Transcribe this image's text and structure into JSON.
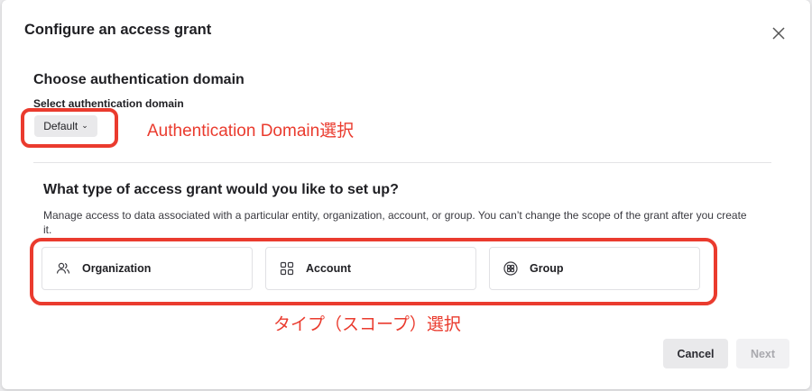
{
  "dialog": {
    "title": "Configure an access grant",
    "close_icon": "close-icon"
  },
  "auth_domain": {
    "heading": "Choose authentication domain",
    "label": "Select authentication domain",
    "selected_value": "Default"
  },
  "scope": {
    "question": "What type of access grant would you like to set up?",
    "description": "Manage access to data associated with a particular entity, organization, account, or group. You can’t change the scope of the grant after you create it.",
    "options": [
      {
        "label": "Organization",
        "icon": "users-icon"
      },
      {
        "label": "Account",
        "icon": "grid-icon"
      },
      {
        "label": "Group",
        "icon": "group-icon"
      }
    ]
  },
  "annotations": {
    "domain_note": "Authentication Domain選択",
    "scope_note": "タイプ（スコープ）選択",
    "color": "#ea3b2e"
  },
  "footer": {
    "cancel_label": "Cancel",
    "next_label": "Next"
  }
}
